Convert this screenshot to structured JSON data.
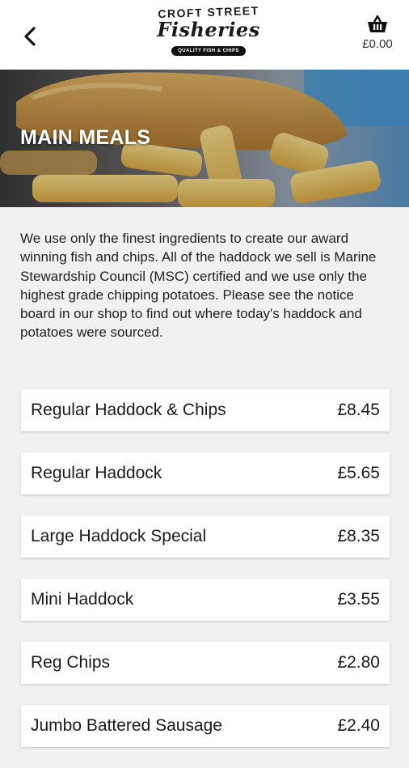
{
  "header": {
    "logo": {
      "line1": "CROFT STREET",
      "line2": "Fisheries",
      "tagline": "QUALITY FISH & CHIPS"
    },
    "basket_total": "£0.00",
    "back_icon": "chevron-left-icon",
    "basket_icon": "basket-icon"
  },
  "hero": {
    "title": "MAIN MEALS"
  },
  "intro": {
    "text": "We use only the finest ingredients to create our award winning fish and chips. All of the haddock we sell is Marine Stewardship Council (MSC) certified and we use only the highest grade chipping potatoes. Please see the notice board in our shop to find out where today's haddock and potatoes were sourced."
  },
  "menu": {
    "items": [
      {
        "name": "Regular Haddock & Chips",
        "price": "£8.45"
      },
      {
        "name": "Regular Haddock",
        "price": "£5.65"
      },
      {
        "name": "Large Haddock Special",
        "price": "£8.35"
      },
      {
        "name": "Mini Haddock",
        "price": "£3.55"
      },
      {
        "name": "Reg Chips",
        "price": "£2.80"
      },
      {
        "name": "Jumbo Battered Sausage",
        "price": "£2.40"
      }
    ]
  },
  "colors": {
    "background": "#f1f1f1",
    "card": "#ffffff",
    "text": "#1a1a1a",
    "hero_accent_blue": "#3d9ad8"
  }
}
